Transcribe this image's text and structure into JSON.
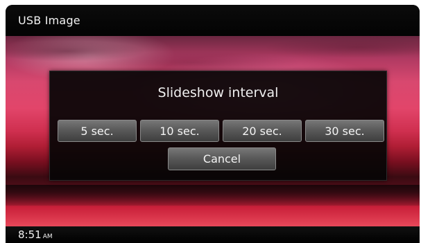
{
  "header": {
    "title": "USB Image"
  },
  "dialog": {
    "title": "Slideshow interval",
    "interval_buttons": [
      {
        "label": "5 sec."
      },
      {
        "label": "10 sec."
      },
      {
        "label": "20 sec."
      },
      {
        "label": "30 sec."
      }
    ],
    "cancel_label": "Cancel"
  },
  "status": {
    "time": "8:51",
    "ampm": "AM"
  },
  "colors": {
    "button_top": "#777777",
    "button_bottom": "#3e3e3e",
    "dialog_bg": "#050505"
  }
}
